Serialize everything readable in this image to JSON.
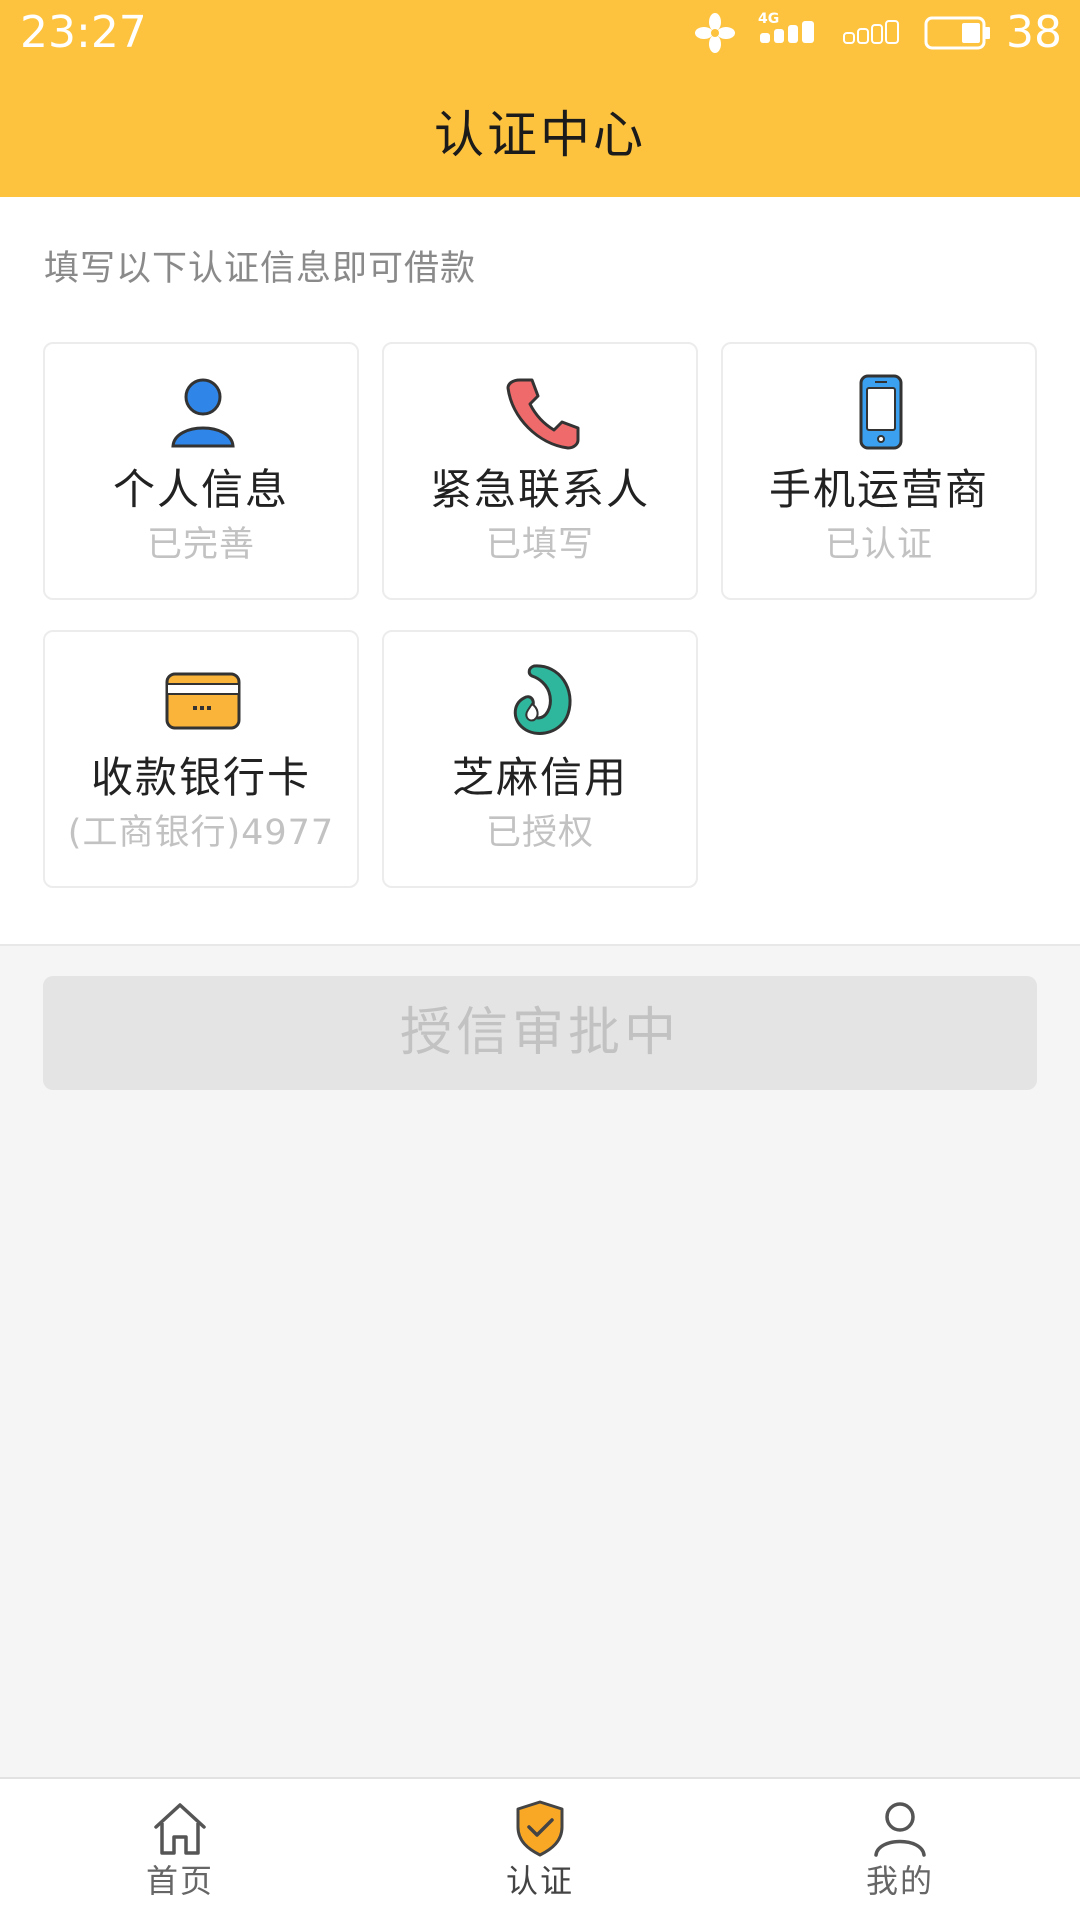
{
  "status_bar": {
    "time": "23:27",
    "battery_level": "38",
    "network_label": "4G"
  },
  "header": {
    "title": "认证中心"
  },
  "intro": "填写以下认证信息即可借款",
  "cards": [
    {
      "title": "个人信息",
      "status": "已完善",
      "icon": "person-icon",
      "accent": "#2f86e8"
    },
    {
      "title": "紧急联系人",
      "status": "已填写",
      "icon": "phone-icon",
      "accent": "#ef6a6a"
    },
    {
      "title": "手机运营商",
      "status": "已认证",
      "icon": "mobile-icon",
      "accent": "#3aa0ef"
    },
    {
      "title": "收款银行卡",
      "status": "(工商银行)4977",
      "icon": "bank-card-icon",
      "accent": "#fbb43a"
    },
    {
      "title": "芝麻信用",
      "status": "已授权",
      "icon": "sesame-credit-icon",
      "accent": "#2eb79c"
    }
  ],
  "submit_button": {
    "label": "授信审批中",
    "disabled": true
  },
  "bottom_nav": {
    "items": [
      {
        "label": "首页",
        "icon": "home-icon",
        "active": false
      },
      {
        "label": "认证",
        "icon": "shield-check-icon",
        "active": true
      },
      {
        "label": "我的",
        "icon": "user-icon",
        "active": false
      }
    ]
  },
  "colors": {
    "brand": "#fdc33f",
    "page_bg": "#f5f5f5",
    "muted_text": "#c2c2c2",
    "button_bg": "#e4e4e4"
  }
}
